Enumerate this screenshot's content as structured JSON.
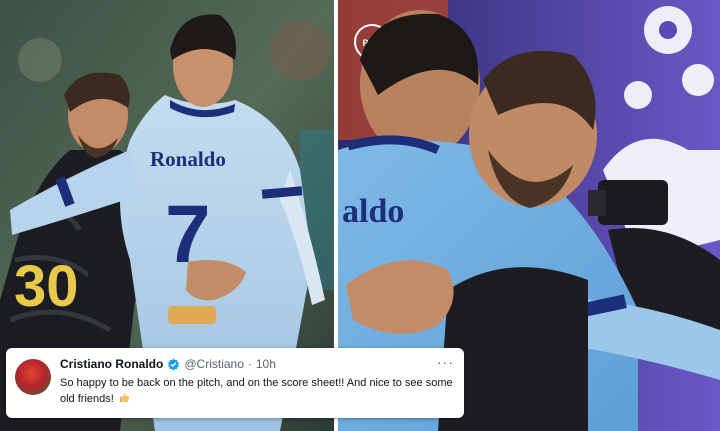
{
  "left_photo": {
    "jersey_name": "Ronaldo",
    "jersey_number": "7",
    "opponent_number": "30"
  },
  "right_photo": {
    "jersey_name_partial": "aldo",
    "badge_text": "PSG"
  },
  "tweet": {
    "display_name": "Cristiano Ronaldo",
    "handle": "@Cristiano",
    "separator": "·",
    "time": "10h",
    "more_label": "···",
    "text": "So happy to be back on the pitch, and on the score sheet!! And nice to see some old friends!",
    "emoji_icon": "thumbs-up-icon",
    "verified_icon": "verified-badge-icon"
  },
  "colors": {
    "twitter_blue": "#1d9bf0",
    "jersey_light_blue": "#a9cce9",
    "jersey_navy": "#1d2f7a",
    "psg_kit_dark": "#1b1d22",
    "psg_number_yellow": "#e8c94a",
    "stadium_purple": "#5a4ab8"
  }
}
